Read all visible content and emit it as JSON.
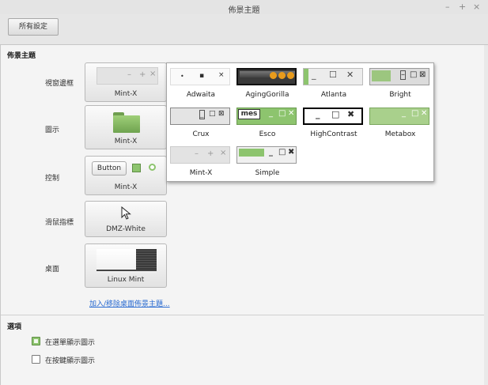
{
  "window": {
    "title": "佈景主題",
    "minimize": "–",
    "maximize": "+",
    "close": "×"
  },
  "toolbar": {
    "all_settings": "所有設定"
  },
  "themes_section": {
    "title": "佈景主題",
    "rows": [
      {
        "label": "視窗邊框",
        "value": "Mint-X"
      },
      {
        "label": "圖示",
        "value": "Mint-X"
      },
      {
        "label": "控制",
        "value": "Mint-X"
      },
      {
        "label": "滑鼠指標",
        "value": "DMZ-White"
      },
      {
        "label": "桌面",
        "value": "Linux Mint"
      }
    ],
    "controls_preview": {
      "button_label": "Button"
    },
    "add_remove_link": "加入/移除桌面佈景主題..."
  },
  "options_section": {
    "title": "選項",
    "items": [
      {
        "label": "在選單顯示圖示",
        "checked": true
      },
      {
        "label": "在按鍵顯示圖示",
        "checked": false
      }
    ]
  },
  "popup": {
    "themes": [
      "Adwaita",
      "AgingGorilla",
      "Atlanta",
      "Bright",
      "Crux",
      "Esco",
      "HighContrast",
      "Metabox",
      "Mint-X",
      "Simple"
    ],
    "esco_preview_text": "mes"
  },
  "glyphs": {
    "dash": "–",
    "plus": "+",
    "times": "×",
    "dot": "•",
    "small_square": "▪",
    "underscore": "_",
    "square": "☐",
    "x": "✕",
    "heavy_x": "✖",
    "box_x": "⊠",
    "box": "□"
  },
  "colors": {
    "accent": "#8dc46e",
    "link": "#2a6bd1",
    "popup_bg": "#ffffff",
    "content_bg": "#f4f4f4"
  }
}
